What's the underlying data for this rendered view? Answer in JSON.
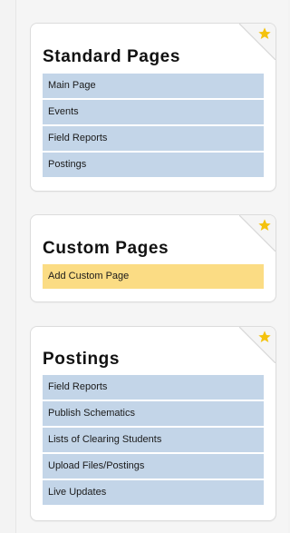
{
  "colors": {
    "link_bg": "#c3d5e8",
    "custom_link_bg": "#fbdc84",
    "star": "#f4c20d",
    "panel_bg": "#ffffff"
  },
  "panels": [
    {
      "title": "Standard Pages",
      "icon": "star-icon",
      "items": [
        {
          "label": "Main Page"
        },
        {
          "label": "Events"
        },
        {
          "label": "Field Reports"
        },
        {
          "label": "Postings"
        }
      ]
    },
    {
      "title": "Custom Pages",
      "icon": "star-icon",
      "items": [
        {
          "label": "Add Custom Page"
        }
      ]
    },
    {
      "title": "Postings",
      "icon": "star-icon",
      "items": [
        {
          "label": "Field Reports"
        },
        {
          "label": "Publish Schematics"
        },
        {
          "label": "Lists of Clearing Students"
        },
        {
          "label": "Upload Files/Postings"
        },
        {
          "label": "Live Updates"
        }
      ]
    }
  ]
}
